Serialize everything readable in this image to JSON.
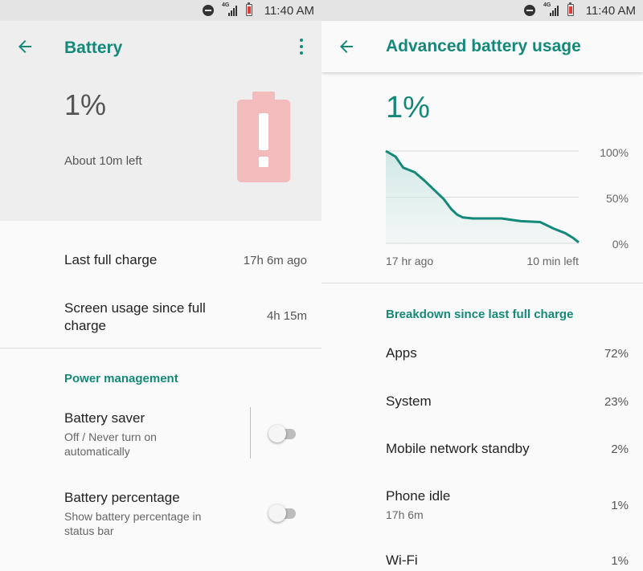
{
  "status_bar": {
    "time": "11:40 AM",
    "network": "4G",
    "icons": [
      "do-not-disturb-icon",
      "signal-icon",
      "battery-low-icon"
    ]
  },
  "left": {
    "header": {
      "title": "Battery",
      "back_icon": "arrow-left-icon",
      "menu_icon": "more-vert-icon"
    },
    "battery_percent": "1%",
    "time_left": "About 10m left",
    "rows": [
      {
        "label": "Last full charge",
        "value": "17h 6m ago"
      },
      {
        "label": "Screen usage since full charge",
        "value": "4h 15m"
      }
    ],
    "power_management": {
      "title": "Power management",
      "battery_saver": {
        "label": "Battery saver",
        "sub": "Off / Never turn on automatically",
        "enabled": false
      },
      "battery_percentage": {
        "label": "Battery percentage",
        "sub": "Show battery percentage in status bar",
        "enabled": false
      }
    }
  },
  "right": {
    "header": {
      "title": "Advanced battery usage",
      "back_icon": "arrow-left-icon"
    },
    "battery_percent": "1%",
    "chart_data": {
      "type": "area",
      "x_label_start": "17 hr ago",
      "x_label_end": "10 min left",
      "y_ticks": [
        "100%",
        "50%",
        "0%"
      ],
      "ylim": [
        0,
        100
      ],
      "x": [
        0,
        0.05,
        0.09,
        0.15,
        0.2,
        0.25,
        0.3,
        0.34,
        0.37,
        0.4,
        0.45,
        0.6,
        0.7,
        0.8,
        0.87,
        0.93,
        0.97,
        1.0
      ],
      "values": [
        100,
        94,
        82,
        77,
        68,
        58,
        48,
        37,
        31,
        28,
        27,
        27,
        24,
        23,
        16,
        11,
        6,
        1
      ],
      "line_color": "#14897a",
      "fill_color": "#cfe8e4"
    },
    "breakdown": {
      "title": "Breakdown since last full charge",
      "items": [
        {
          "label": "Apps",
          "value": "72%"
        },
        {
          "label": "System",
          "value": "23%"
        },
        {
          "label": "Mobile network standby",
          "value": "2%"
        },
        {
          "label": "Phone idle",
          "sub": "17h 6m",
          "value": "1%"
        },
        {
          "label": "Wi-Fi",
          "value": "1%"
        }
      ]
    }
  }
}
